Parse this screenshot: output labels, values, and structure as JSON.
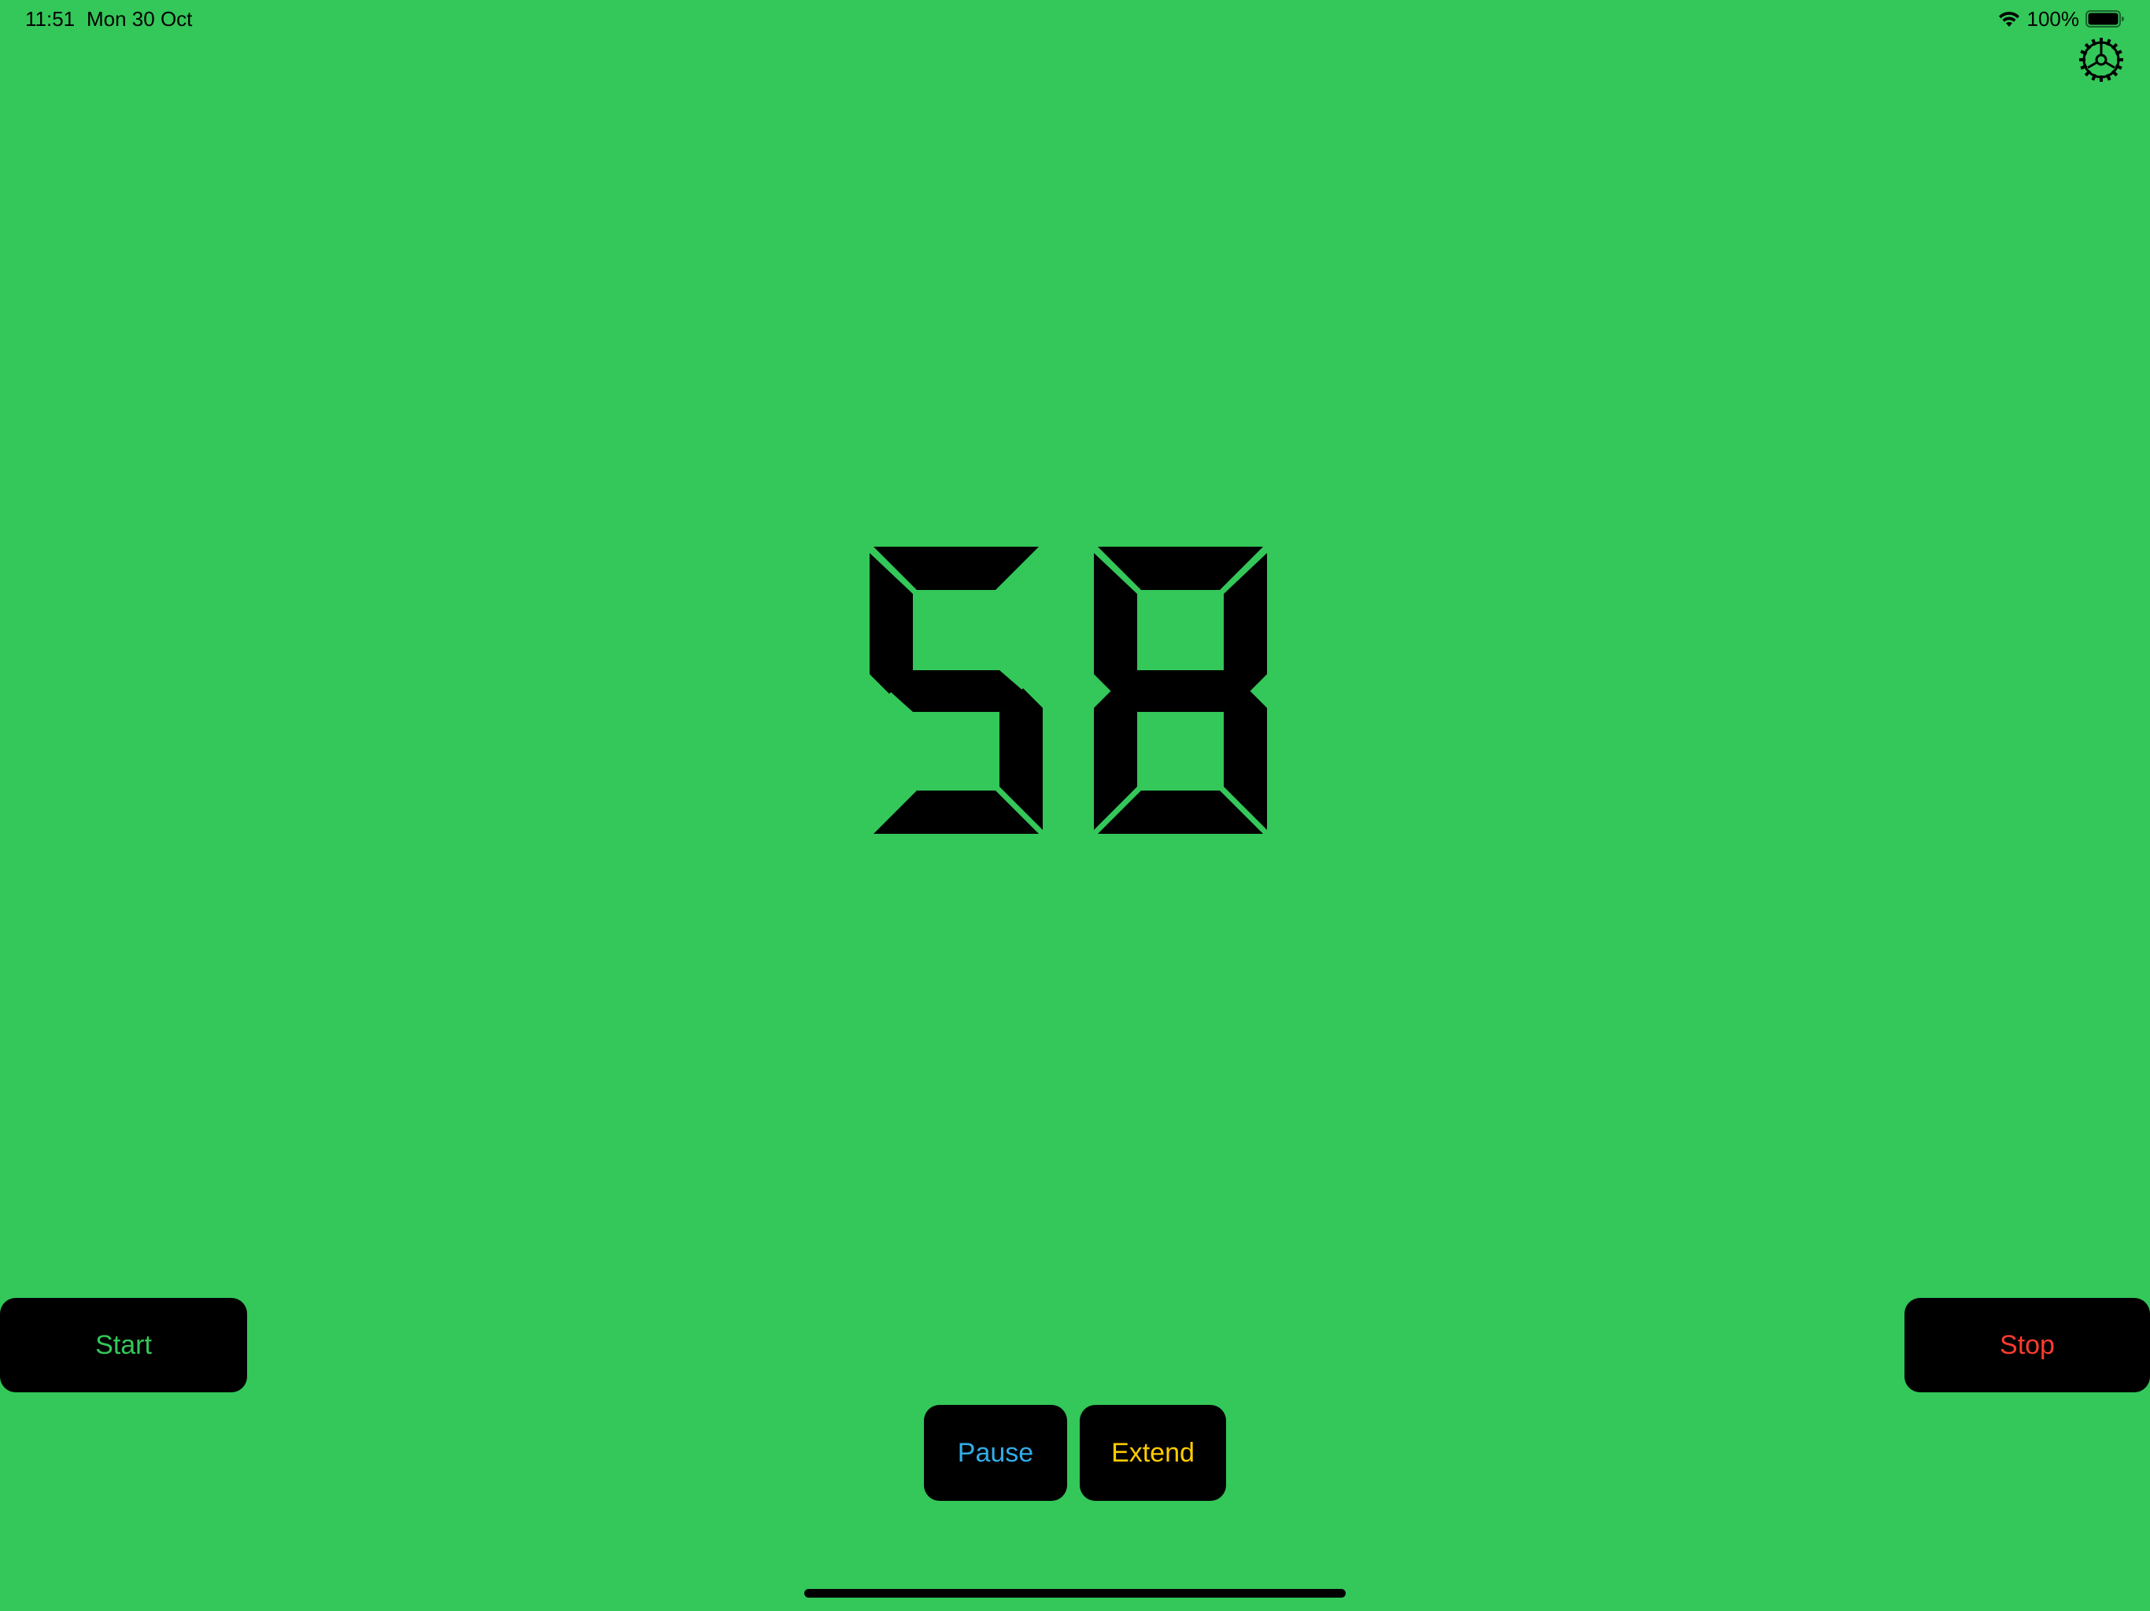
{
  "status_bar": {
    "time": "11:51",
    "date": "Mon 30 Oct",
    "battery_percent": "100%",
    "wifi_icon": "wifi-icon",
    "battery_icon": "battery-full-icon"
  },
  "settings": {
    "icon": "gear-icon"
  },
  "timer": {
    "value": "58",
    "digits": [
      "5",
      "8"
    ],
    "display_style": "seven-segment"
  },
  "buttons": {
    "start_label": "Start",
    "stop_label": "Stop",
    "pause_label": "Pause",
    "extend_label": "Extend"
  },
  "colors": {
    "background": "#34c759",
    "start_text": "#34c759",
    "stop_text": "#ff3b30",
    "pause_text": "#32ade6",
    "extend_text": "#ffcc00",
    "segment": "#000000"
  }
}
